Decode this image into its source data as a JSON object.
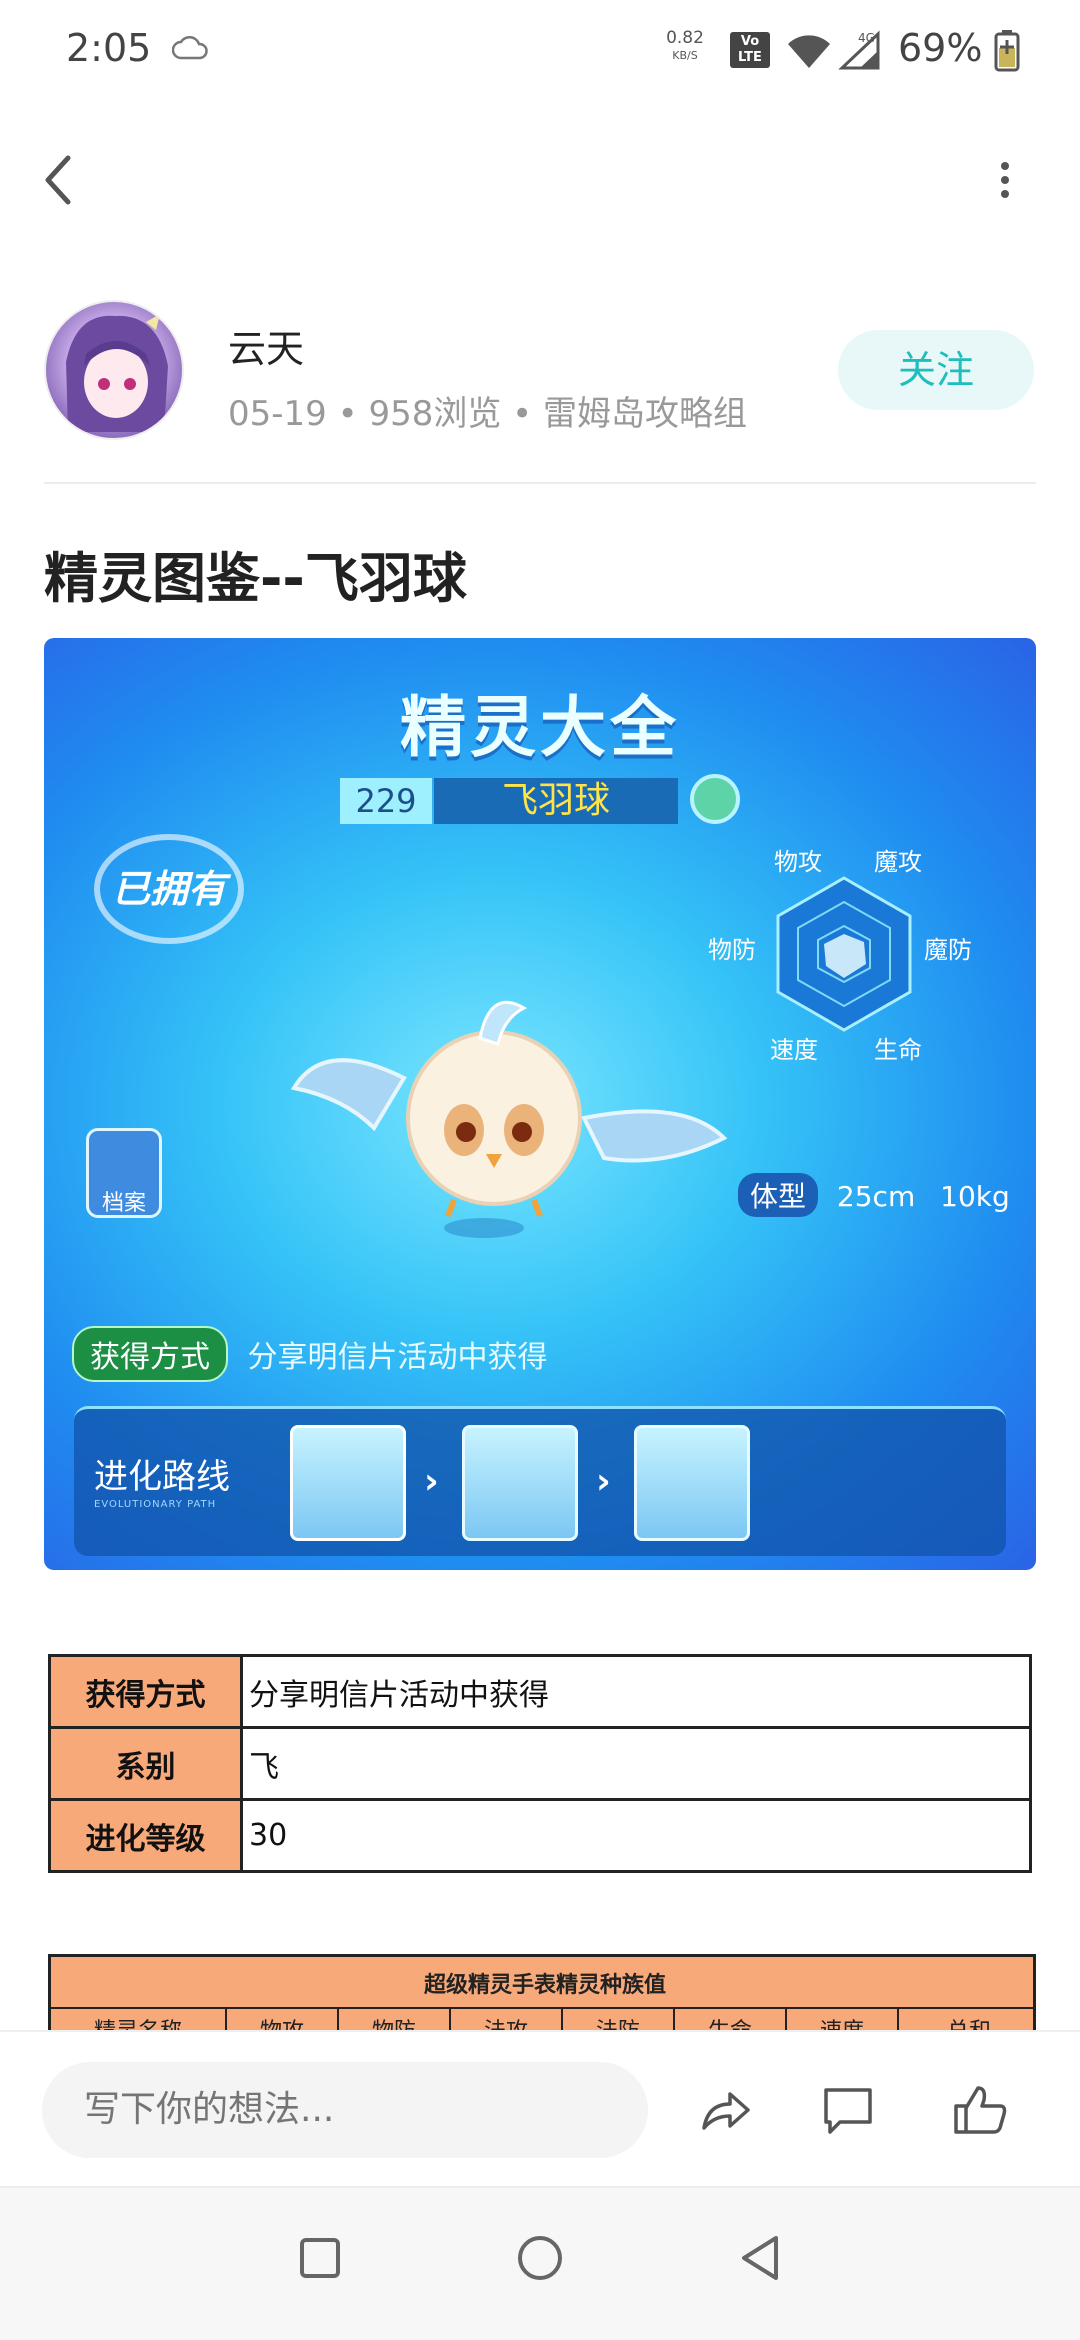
{
  "status_bar": {
    "time": "2:05",
    "speed_value": "0.82",
    "speed_unit": "KB/S",
    "volte_line1": "Vo",
    "volte_line2": "LTE",
    "network": "4G",
    "battery": "69%"
  },
  "author": {
    "name": "云天",
    "meta": "05-19 • 958浏览 • 雷姆岛攻略组",
    "follow_label": "关注"
  },
  "article": {
    "title": "精灵图鉴--飞羽球"
  },
  "game_image": {
    "title": "精灵大全",
    "number": "229",
    "name": "飞羽球",
    "owned_label": "已拥有",
    "archive_label": "档案",
    "radar_labels": {
      "phys_atk": "物攻",
      "mag_atk": "魔攻",
      "phys_def": "物防",
      "mag_def": "魔防",
      "speed": "速度",
      "hp": "生命"
    },
    "size_label": "体型",
    "height": "25cm",
    "weight": "10kg",
    "obtain_tag": "获得方式",
    "obtain_text": "分享明信片活动中获得",
    "evolution_label": "进化路线",
    "evolution_sub": "EVOLUTIONARY PATH"
  },
  "info_table": {
    "rows": [
      {
        "label": "获得方式",
        "value": "分享明信片活动中获得"
      },
      {
        "label": "系别",
        "value": "飞"
      },
      {
        "label": "进化等级",
        "value": "30"
      }
    ]
  },
  "race_table": {
    "title": "超级精灵手表精灵种族值",
    "headers": [
      "精灵名称",
      "物攻",
      "物防",
      "法攻",
      "法防",
      "生命",
      "速度",
      "总和"
    ]
  },
  "comment_bar": {
    "placeholder": "写下你的想法..."
  },
  "colors": {
    "accent": "#20bdbd",
    "table_header": "#f8a97a"
  }
}
